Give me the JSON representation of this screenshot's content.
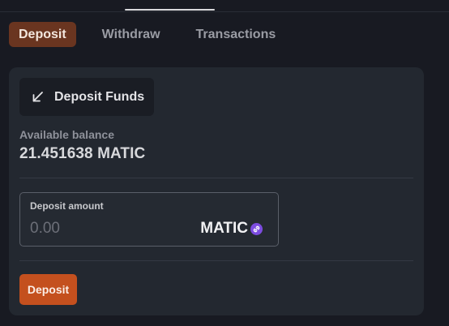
{
  "tabs": [
    {
      "label": "Deposit",
      "active": true
    },
    {
      "label": "Withdraw",
      "active": false
    },
    {
      "label": "Transactions",
      "active": false
    }
  ],
  "card": {
    "title": "Deposit Funds",
    "title_icon": "arrow-down-left-icon",
    "balance_label": "Available balance",
    "balance_value": "21.451638 MATIC"
  },
  "amount": {
    "label": "Deposit amount",
    "value": "",
    "placeholder": "0.00",
    "currency": "MATIC",
    "currency_icon": "matic-icon"
  },
  "actions": {
    "deposit_label": "Deposit"
  },
  "colors": {
    "background": "#181a22",
    "card": "#232830",
    "accent": "#c4501e",
    "active_tab": "#6a3520",
    "matic": "#7c4ce0"
  }
}
